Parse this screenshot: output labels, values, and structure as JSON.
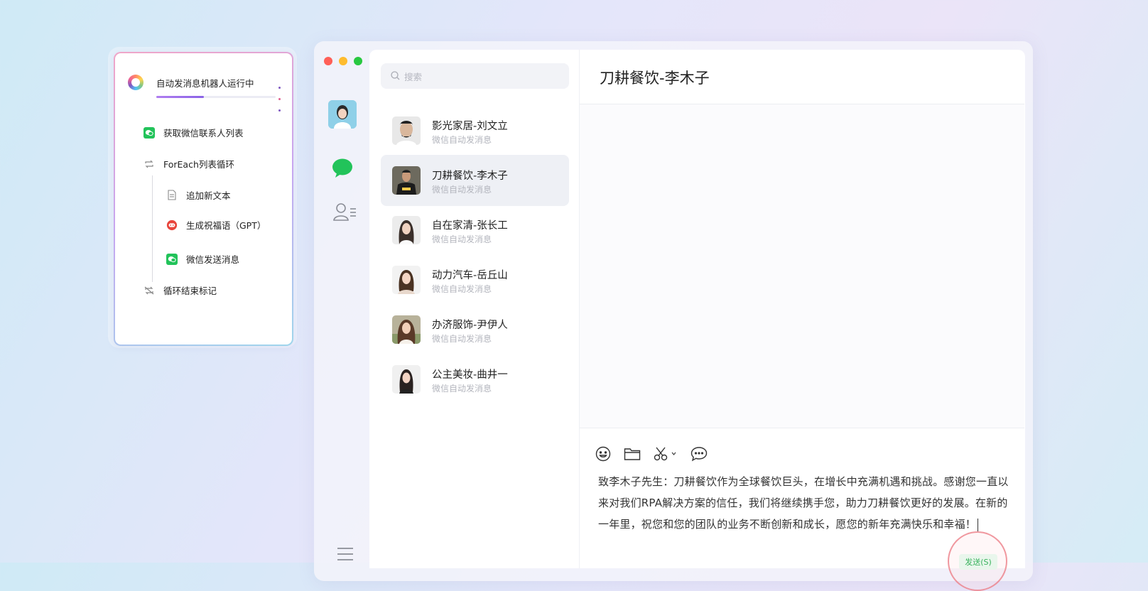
{
  "workflow": {
    "title": "自动发消息机器人运行中",
    "progress": 0.4,
    "steps": [
      {
        "label": "获取微信联系人列表",
        "icon": "wechat-icon"
      },
      {
        "label": "ForEach列表循环",
        "icon": "loop-icon"
      },
      {
        "label": "追加新文本",
        "icon": "document-icon"
      },
      {
        "label": "生成祝福语（GPT）",
        "icon": "gpt-icon"
      },
      {
        "label": "微信发送消息",
        "icon": "wechat-icon"
      },
      {
        "label": "循环结束标记",
        "icon": "loop-end-icon"
      }
    ]
  },
  "app": {
    "search_placeholder": "搜索",
    "contacts": [
      {
        "name": "影光家居-刘文立",
        "sub": "微信自动发消息"
      },
      {
        "name": "刀耕餐饮-李木子",
        "sub": "微信自动发消息"
      },
      {
        "name": "自在家清-张长工",
        "sub": "微信自动发消息"
      },
      {
        "name": "动力汽车-岳丘山",
        "sub": "微信自动发消息"
      },
      {
        "name": "办济服饰-尹伊人",
        "sub": "微信自动发消息"
      },
      {
        "name": "公主美妆-曲井一",
        "sub": "微信自动发消息"
      }
    ],
    "selected_contact": 1,
    "chat": {
      "title": "刀耕餐饮-李木子",
      "message": "致李木子先生：刀耕餐饮作为全球餐饮巨头，在增长中充满机遇和挑战。感谢您一直以来对我们RPA解决方案的信任，我们将继续携手您，助力刀耕餐饮更好的发展。在新的一年里，祝您和您的团队的业务不断创新和成长，愿您的新年充满快乐和幸福！",
      "send_label": "发送(S)"
    }
  },
  "colors": {
    "accent_purple": "#8a62e6",
    "wechat_green": "#22c35a",
    "window_red": "#ff5f57",
    "window_yellow": "#febc2e",
    "window_green": "#28c840"
  }
}
